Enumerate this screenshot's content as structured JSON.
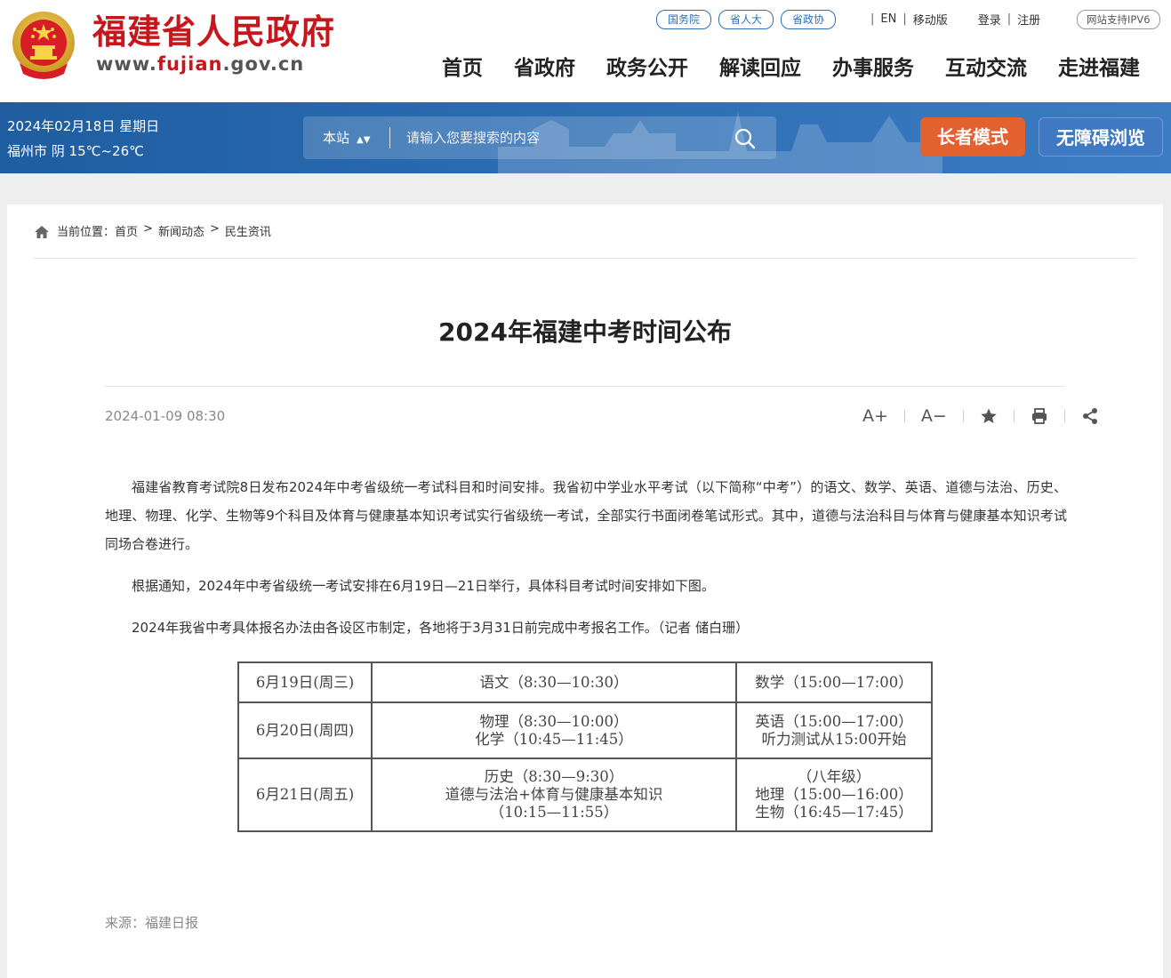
{
  "header": {
    "site_name": "福建省人民政府",
    "url_prefix": "www.",
    "url_highlight": "fujian",
    "url_suffix": ".gov.cn",
    "quick_links": [
      "国务院",
      "省人大",
      "省政协"
    ],
    "util_links": {
      "en": "EN",
      "mobile": "移动版",
      "login": "登录",
      "register": "注册"
    },
    "ipv6_badge": "网站支持IPV6",
    "nav": [
      "首页",
      "省政府",
      "政务公开",
      "解读回应",
      "办事服务",
      "互动交流",
      "走进福建"
    ]
  },
  "band": {
    "date": "2024年02月18日 星期日",
    "weather": "福州市 阴 15℃~26℃",
    "search_scope": "本站",
    "search_placeholder": "请输入您要搜索的内容",
    "elder_mode_label": "长者模式",
    "accessible_label": "无障碍浏览",
    "colors": {
      "band": "#2a6ab0",
      "elder": "#e2612f",
      "accessible": "#3f78c3"
    }
  },
  "breadcrumb": {
    "prefix": "当前位置：",
    "items": [
      "首页",
      "新闻动态",
      "民生资讯"
    ],
    "separator": ">"
  },
  "article": {
    "title": "2024年福建中考时间公布",
    "date": "2024-01-09 08:30",
    "tools": {
      "font_up": "A+",
      "font_down": "A−"
    },
    "paragraphs": [
      "福建省教育考试院8日发布2024年中考省级统一考试科目和时间安排。我省初中学业水平考试（以下简称“中考”）的语文、数学、英语、道德与法治、历史、地理、物理、化学、生物等9个科目及体育与健康基本知识考试实行省级统一考试，全部实行书面闭卷笔试形式。其中，道德与法治科目与体育与健康基本知识考试同场合卷进行。",
      "根据通知，2024年中考省级统一考试安排在6月19日—21日举行，具体科目考试时间安排如下图。",
      "2024年我省中考具体报名办法由各设区市制定，各地将于3月31日前完成中考报名工作。（记者 储白珊）"
    ],
    "schedule": [
      {
        "date": "6月19日(周三)",
        "morning": [
          "语文（8:30—10:30）"
        ],
        "afternoon": [
          "数学（15:00—17:00）"
        ]
      },
      {
        "date": "6月20日(周四)",
        "morning": [
          "物理（8:30—10:00）",
          "化学（10:45—11:45）"
        ],
        "afternoon": [
          "英语（15:00—17:00）",
          "听力测试从15:00开始"
        ]
      },
      {
        "date": "6月21日(周五)",
        "morning": [
          "历史（8:30—9:30）",
          "道德与法治+体育与健康基本知识",
          "（10:15—11:55）"
        ],
        "afternoon": [
          "（八年级）",
          "地理（15:00—16:00）",
          "生物（16:45—17:45）"
        ]
      }
    ],
    "source": "来源：福建日报"
  },
  "icons": {
    "emblem": "national-emblem-icon",
    "search": "search-icon",
    "home": "home-icon",
    "favorite": "star-icon",
    "print": "print-icon",
    "share": "share-icon"
  }
}
